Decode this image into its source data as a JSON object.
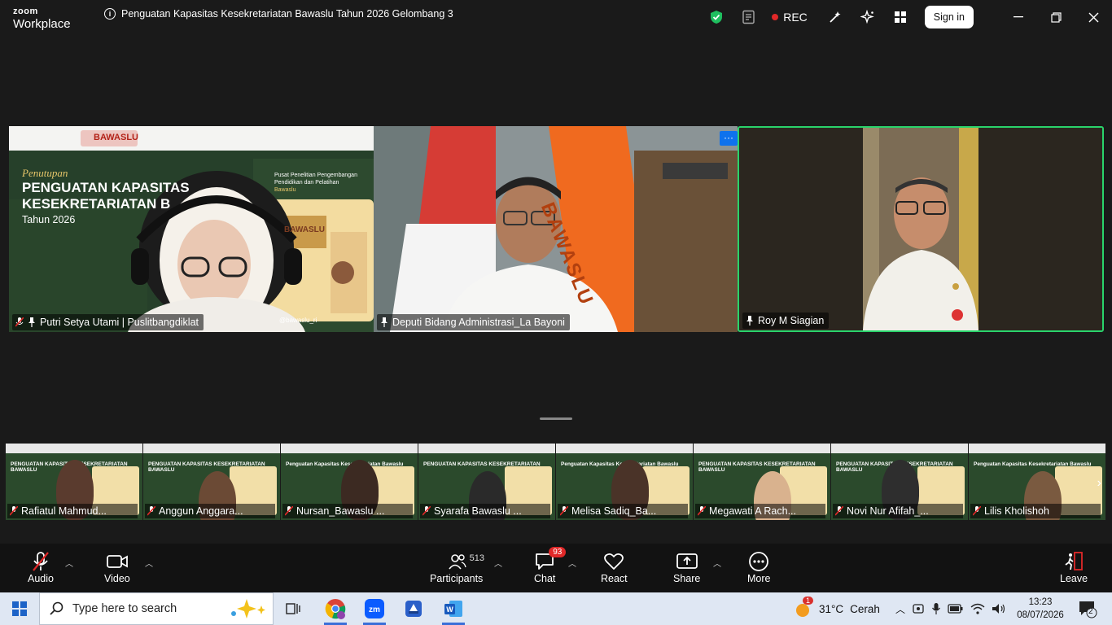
{
  "titlebar": {
    "brand_line1": "zoom",
    "brand_line2": "Workplace",
    "meeting_title": "Penguatan Kapasitas Kesekretariatan Bawaslu Tahun 2026 Gelombang 3",
    "rec_label": "REC",
    "signin_label": "Sign in"
  },
  "main_tiles": [
    {
      "name": "Putri Setya Utami | Puslitbangdiklat",
      "muted": true,
      "pinned": true,
      "slide_lines": [
        "BAWASLU",
        "Penutupan",
        "PENGUATAN KAPASITAS",
        "KESEKRETARIATAN B",
        "Tahun 2026",
        "Pusat Penelitian Pengembangan",
        "Pendidikan dan Pelatihan",
        "Bawaslu",
        "BAWASLU",
        "@bawaslu_ri"
      ]
    },
    {
      "name": "Deputi Bidang Administrasi_La Bayoni",
      "muted": false,
      "pinned": true,
      "flag_text": "BAWASLU",
      "more": "···"
    },
    {
      "name": "Roy M Siagian",
      "muted": false,
      "pinned": true,
      "active_speaker": true
    }
  ],
  "filmstrip": [
    {
      "name": "Rafiatul Mahmud...",
      "slide": "PENGUATAN KAPASITAS KESEKRETARIATAN BAWASLU"
    },
    {
      "name": "Anggun Anggara...",
      "slide": "PENGUATAN KAPASITAS KESEKRETARIATAN BAWASLU"
    },
    {
      "name": "Nursan_Bawaslu ...",
      "slide": "Penguatan Kapasitas Kesekretariatan Bawaslu"
    },
    {
      "name": "Syarafa Bawaslu ...",
      "slide": "PENGUATAN KAPASITAS KESEKRETARIATAN"
    },
    {
      "name": "Melisa Sadiq_Ba...",
      "slide": "Penguatan Kapasitas Kesekretariatan Bawaslu"
    },
    {
      "name": "Megawati A Rach...",
      "slide": "PENGUATAN KAPASITAS KESEKRETARIATAN BAWASLU"
    },
    {
      "name": "Novi Nur Afifah_...",
      "slide": "PENGUATAN KAPASITAS KESEKRETARIATAN BAWASLU"
    },
    {
      "name": "Lilis Kholishoh",
      "slide": "Penguatan Kapasitas Kesekretariatan Bawaslu"
    }
  ],
  "toolbar": {
    "audio": "Audio",
    "video": "Video",
    "participants": "Participants",
    "participants_count": "513",
    "chat": "Chat",
    "chat_badge": "93",
    "react": "React",
    "share": "Share",
    "more": "More",
    "leave": "Leave"
  },
  "taskbar": {
    "search_placeholder": "Type here to search",
    "weather_temp": "31°C",
    "weather_text": "Cerah",
    "weather_badge": "1",
    "time": "13:23",
    "date": "08/07/2026",
    "notif_count": "2"
  },
  "colors": {
    "active_speaker_border": "#2ad36b",
    "rec_dot": "#e02828",
    "shield": "#1fbf5f",
    "share_blue": "#3a6fd8"
  }
}
